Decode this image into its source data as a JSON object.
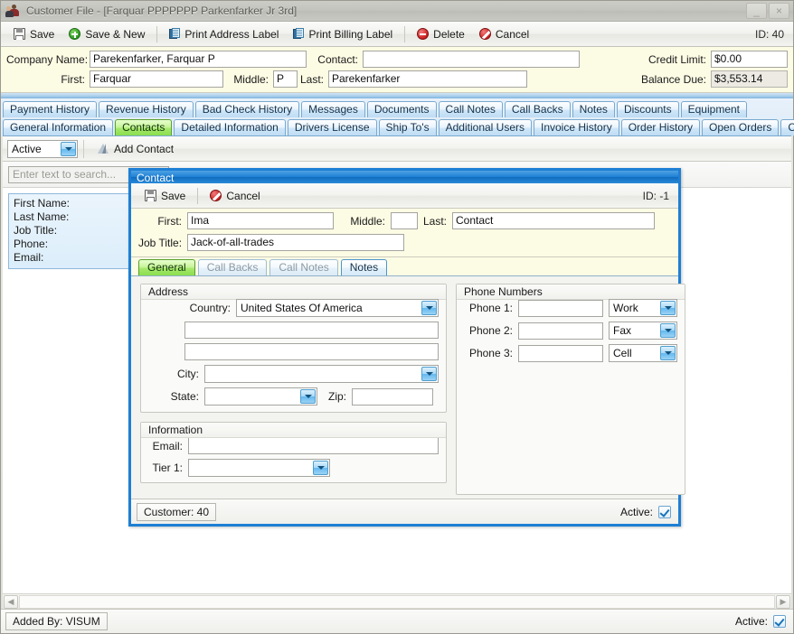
{
  "window": {
    "title": "Customer File - [Farquar PPPPPPP Parkenfarker Jr 3rd]",
    "icon": "contacts-icon",
    "minimize_label": "_",
    "close_label": "×"
  },
  "toolbar": {
    "save_label": "Save",
    "save_new_label": "Save & New",
    "print_address_label": "Print Address Label",
    "print_billing_label": "Print Billing Label",
    "delete_label": "Delete",
    "cancel_label": "Cancel",
    "id_label": "ID: 40"
  },
  "header_fields": {
    "company_name_label": "Company Name:",
    "company_name_value": "Parekenfarker, Farquar P",
    "contact_label": "Contact:",
    "contact_value": "",
    "first_label": "First:",
    "first_value": "Farquar",
    "middle_label": "Middle:",
    "middle_value": "P",
    "last_label": "Last:",
    "last_value": "Parekenfarker",
    "credit_limit_label": "Credit Limit:",
    "credit_limit_value": "$0.00",
    "balance_due_label": "Balance Due:",
    "balance_due_value": "$3,553.14"
  },
  "tabs_top": [
    {
      "label": "Payment History",
      "active": false
    },
    {
      "label": "Revenue History",
      "active": false
    },
    {
      "label": "Bad Check History",
      "active": false
    },
    {
      "label": "Messages",
      "active": false
    },
    {
      "label": "Documents",
      "active": false
    },
    {
      "label": "Call Notes",
      "active": false
    },
    {
      "label": "Call Backs",
      "active": false
    },
    {
      "label": "Notes",
      "active": false
    },
    {
      "label": "Discounts",
      "active": false
    },
    {
      "label": "Equipment",
      "active": false
    }
  ],
  "tabs_bottom": [
    {
      "label": "General Information",
      "active": false
    },
    {
      "label": "Contacts",
      "active": true
    },
    {
      "label": "Detailed Information",
      "active": false
    },
    {
      "label": "Drivers License",
      "active": false
    },
    {
      "label": "Ship To's",
      "active": false
    },
    {
      "label": "Additional Users",
      "active": false
    },
    {
      "label": "Invoice History",
      "active": false
    },
    {
      "label": "Order History",
      "active": false
    },
    {
      "label": "Open Orders",
      "active": false
    },
    {
      "label": "Credit History",
      "active": false
    }
  ],
  "contacts_panel": {
    "filter_value": "Active",
    "add_contact_label": "Add Contact",
    "search_placeholder": "Enter text to search...",
    "search_value": "",
    "card": {
      "first_name_label": "First Name:",
      "last_name_label": "Last Name:",
      "job_title_label": "Job Title:",
      "phone_label": "Phone:",
      "email_label": "Email:"
    }
  },
  "scrollbar": {
    "left_arrow": "◀",
    "right_arrow": "▶"
  },
  "statusbar": {
    "added_by": "Added By: VISUM",
    "active_label": "Active:",
    "active_checked": true
  },
  "contact_dialog": {
    "title": "Contact",
    "save_label": "Save",
    "cancel_label": "Cancel",
    "id_label": "ID: -1",
    "fields": {
      "first_label": "First:",
      "first_value": "Ima",
      "middle_label": "Middle:",
      "middle_value": "",
      "last_label": "Last:",
      "last_value": "Contact",
      "job_title_label": "Job Title:",
      "job_title_value": "Jack-of-all-trades"
    },
    "tabs": [
      {
        "label": "General",
        "state": "active"
      },
      {
        "label": "Call Backs",
        "state": "disabled"
      },
      {
        "label": "Call Notes",
        "state": "disabled"
      },
      {
        "label": "Notes",
        "state": "enabled"
      }
    ],
    "address": {
      "group_title": "Address",
      "country_label": "Country:",
      "country_value": "United States Of America",
      "line1_value": "",
      "line2_value": "",
      "city_label": "City:",
      "city_value": "",
      "state_label": "State:",
      "state_value": "",
      "zip_label": "Zip:",
      "zip_value": ""
    },
    "phones": {
      "group_title": "Phone Numbers",
      "rows": [
        {
          "label": "Phone 1:",
          "number": "",
          "type": "Work"
        },
        {
          "label": "Phone 2:",
          "number": "",
          "type": "Fax"
        },
        {
          "label": "Phone 3:",
          "number": "",
          "type": "Cell"
        }
      ]
    },
    "information": {
      "group_title": "Information",
      "email_label": "Email:",
      "email_value": "",
      "tier1_label": "Tier 1:",
      "tier1_value": ""
    },
    "footer": {
      "customer_label": "Customer: 40",
      "active_label": "Active:",
      "active_checked": true
    }
  },
  "colors": {
    "accent_blue": "#1e7fd4",
    "tab_active_green": "#8ade4e",
    "header_cream": "#fcfbe4",
    "titlebar_gray": "#c3c3bd"
  }
}
